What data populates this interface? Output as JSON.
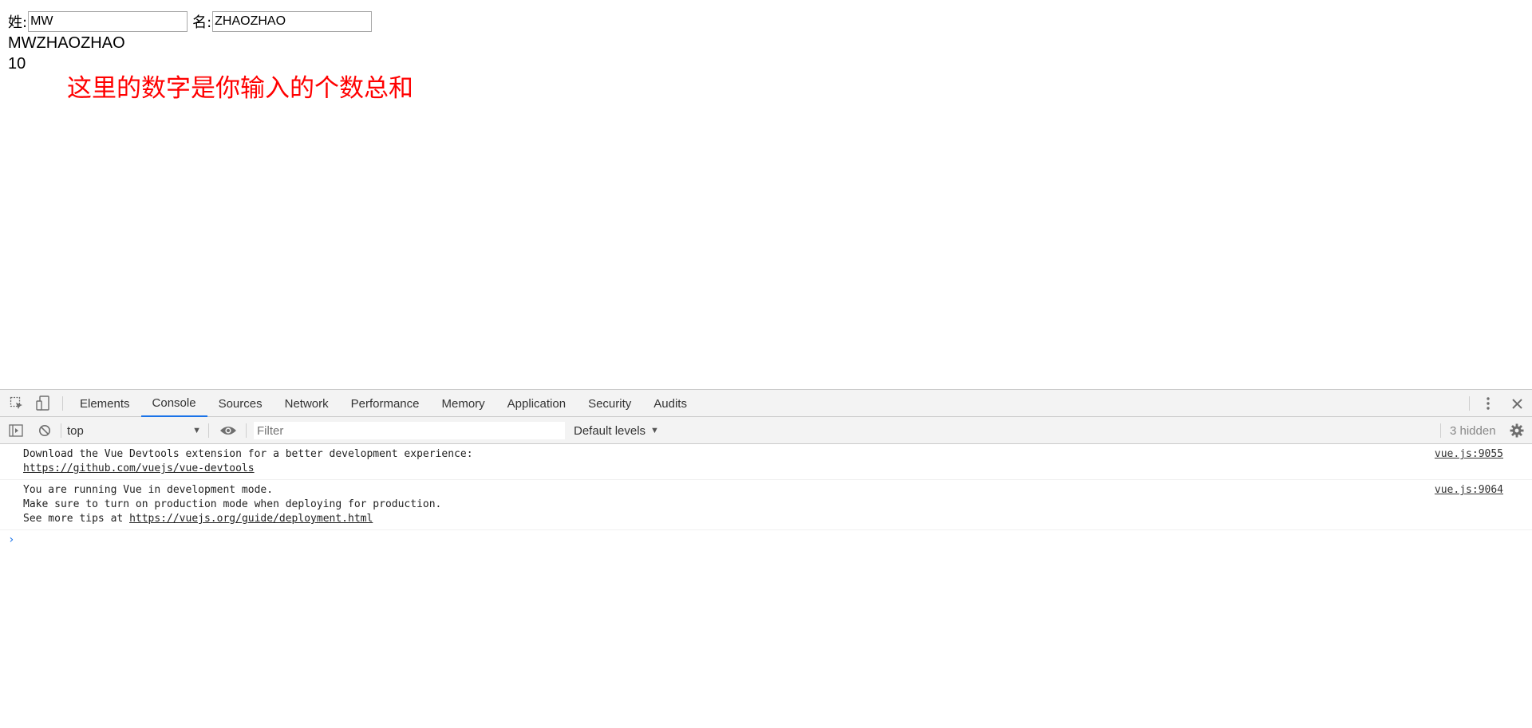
{
  "page": {
    "last_name_label": "姓:",
    "last_name_value": "MW",
    "first_name_label": "名:",
    "first_name_value": "ZHAOZHAO",
    "full_name": "MWZHAOZHAO",
    "count": "10",
    "note": "这里的数字是你输入的个数总和",
    "note_color": "#ff0000"
  },
  "devtools": {
    "icons": {
      "inspect": "inspect-element-icon",
      "device": "device-toolbar-icon",
      "more": "more-vertical-icon",
      "close": "close-icon",
      "sidebar": "console-sidebar-icon",
      "clear": "clear-console-icon",
      "eye": "live-expression-eye-icon",
      "settings": "gear-icon"
    },
    "tabs": [
      "Elements",
      "Console",
      "Sources",
      "Network",
      "Performance",
      "Memory",
      "Application",
      "Security",
      "Audits"
    ],
    "active_tab": "Console",
    "accent_color": "#1a73e8",
    "context": "top",
    "filter_placeholder": "Filter",
    "levels": "Default levels",
    "hidden": "3 hidden",
    "messages": [
      {
        "line1": "Download the Vue Devtools extension for a better development experience:",
        "link": "https://github.com/vuejs/vue-devtools",
        "source": "vue.js:9055"
      },
      {
        "line1": "You are running Vue in development mode.",
        "line2": "Make sure to turn on production mode when deploying for production.",
        "line3_prefix": "See more tips at ",
        "link": "https://vuejs.org/guide/deployment.html",
        "source": "vue.js:9064"
      }
    ],
    "prompt": "›"
  }
}
